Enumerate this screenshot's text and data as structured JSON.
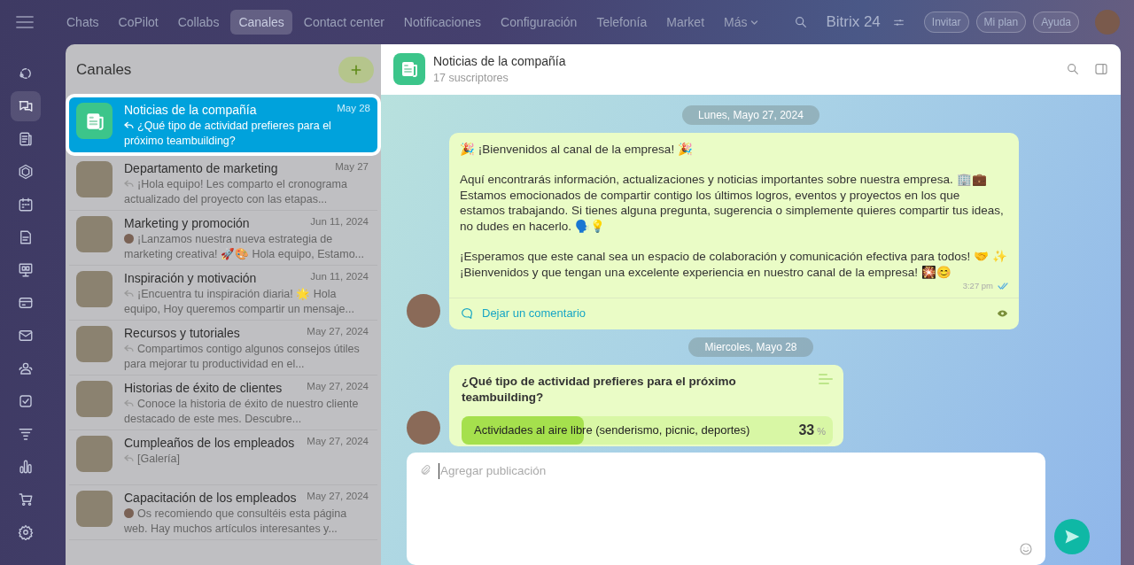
{
  "top_nav": {
    "tabs": [
      {
        "label": "Chats",
        "selected": false
      },
      {
        "label": "CoPilot",
        "selected": false
      },
      {
        "label": "Collabs",
        "selected": false
      },
      {
        "label": "Canales",
        "selected": true
      },
      {
        "label": "Contact center",
        "selected": false
      },
      {
        "label": "Notificaciones",
        "selected": false
      },
      {
        "label": "Configuración",
        "selected": false
      },
      {
        "label": "Telefonía",
        "selected": false
      },
      {
        "label": "Market",
        "selected": false
      },
      {
        "label": "Más",
        "selected": false
      }
    ],
    "brand": "Bitrix 24",
    "buttons": [
      "Invitar",
      "Mi plan",
      "Ayuda"
    ]
  },
  "rail": [
    {
      "kind": "copilot",
      "selected": false
    },
    {
      "kind": "chats",
      "selected": true
    },
    {
      "kind": "news",
      "selected": false
    },
    {
      "kind": "hexagon",
      "selected": false
    },
    {
      "kind": "calendar",
      "selected": false
    },
    {
      "kind": "document",
      "selected": false
    },
    {
      "kind": "board",
      "selected": false
    },
    {
      "kind": "card",
      "selected": false
    },
    {
      "kind": "mail",
      "selected": false
    },
    {
      "kind": "people",
      "selected": false
    },
    {
      "kind": "task",
      "selected": false
    },
    {
      "kind": "funnel",
      "selected": false
    },
    {
      "kind": "chart",
      "selected": false
    },
    {
      "kind": "cart",
      "selected": false
    },
    {
      "kind": "settings",
      "selected": false
    }
  ],
  "channels": {
    "title": "Canales",
    "items": [
      {
        "name": "Noticias de la compañía",
        "date": "May 28",
        "preview": {
          "kind": "reply",
          "text": "¿Qué tipo de actividad prefieres para el próximo teambuilding?"
        },
        "thumb": {
          "kind": "logo"
        },
        "selected": true
      },
      {
        "name": "Departamento de marketing",
        "date": "May 27",
        "preview": {
          "kind": "reply",
          "text": "¡Hola equipo! Les comparto el cronograma actualizado del proyecto con las etapas..."
        },
        "thumb": {
          "kind": "photo"
        },
        "selected": false
      },
      {
        "name": "Marketing y promoción",
        "date": "Jun 11, 2024",
        "preview": {
          "kind": "avatar",
          "text": "¡Lanzamos nuestra nueva estrategia de marketing creativa! 🚀🎨 Hola equipo, Estamo..."
        },
        "thumb": {
          "kind": "photo"
        },
        "selected": false
      },
      {
        "name": "Inspiración y motivación",
        "date": "Jun 11, 2024",
        "preview": {
          "kind": "reply",
          "text": "¡Encuentra tu inspiración diaria! 🌟 Hola equipo, Hoy queremos compartir un mensaje..."
        },
        "thumb": {
          "kind": "photo"
        },
        "selected": false
      },
      {
        "name": "Recursos y tutoriales",
        "date": "May 27, 2024",
        "preview": {
          "kind": "reply",
          "text": "Compartimos contigo algunos consejos útiles para mejorar tu productividad en el..."
        },
        "thumb": {
          "kind": "photo"
        },
        "selected": false
      },
      {
        "name": "Historias de éxito de clientes",
        "date": "May 27, 2024",
        "preview": {
          "kind": "reply",
          "text": "Conoce la historia de éxito de nuestro cliente destacado de este mes. Descubre..."
        },
        "thumb": {
          "kind": "photo"
        },
        "selected": false
      },
      {
        "name": "Cumpleaños de los empleados",
        "date": "May 27, 2024",
        "preview": {
          "kind": "reply",
          "text": "[Galería]"
        },
        "thumb": {
          "kind": "photo"
        },
        "selected": false
      },
      {
        "name": "Capacitación de los empleados",
        "date": "May 27, 2024",
        "preview": {
          "kind": "avatar",
          "text": "Os recomiendo que consultéis esta página web. Hay muchos artículos interesantes y..."
        },
        "thumb": {
          "kind": "photo"
        },
        "selected": false
      }
    ]
  },
  "chat": {
    "title": "Noticias de la compañía",
    "subtitle": "17 suscriptores",
    "feed": [
      {
        "kind": "date",
        "text": "Lunes, Mayo 27, 2024"
      },
      {
        "kind": "post",
        "paragraphs": [
          "🎉 ¡Bienvenidos al canal de la empresa! 🎉",
          "Aquí encontrarás información, actualizaciones y noticias importantes sobre nuestra empresa. 🏢💼 Estamos emocionados de compartir contigo los últimos logros, eventos y proyectos en los que estamos trabajando. Si tienes alguna pregunta, sugerencia o simplemente quieres compartir tus ideas, no dudes en hacerlo. 🗣️💡",
          "¡Esperamos que este canal sea un espacio de colaboración y comunicación efectiva para todos! 🤝 ✨ ¡Bienvenidos y que tengan una excelente experiencia en nuestro canal de la empresa! 🎇😊"
        ],
        "time": "3:27 pm",
        "read": true,
        "comment": "Dejar un comentario"
      },
      {
        "kind": "date",
        "text": "Miercoles, Mayo 28"
      },
      {
        "kind": "poll",
        "question": "¿Qué tipo de actividad prefieres para el próximo teambuilding?",
        "options": [
          {
            "label": "Actividades al aire libre (senderismo, picnic, deportes)",
            "percent": "33",
            "unit": "%",
            "level": 0.33
          }
        ]
      }
    ],
    "composer": {
      "placeholder": "Agregar publicación"
    }
  }
}
